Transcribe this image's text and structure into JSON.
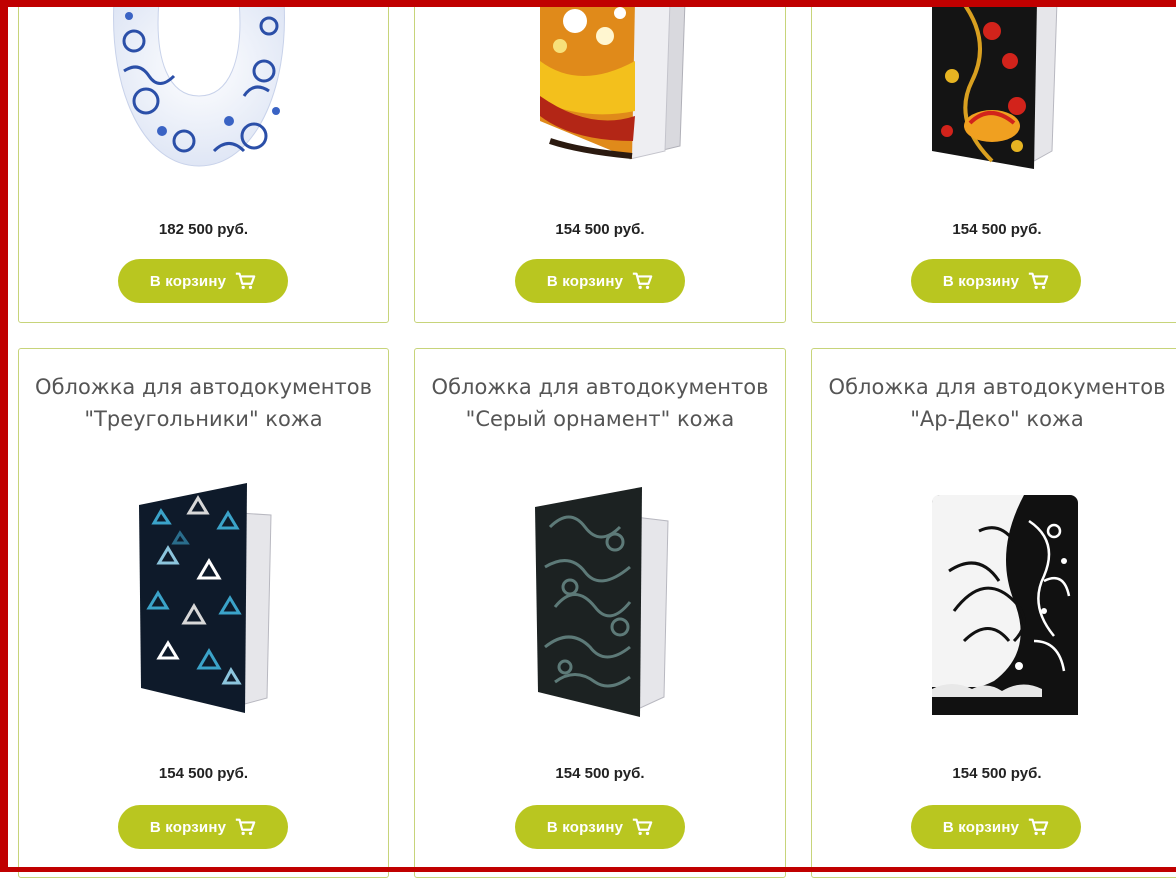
{
  "products": [
    {
      "title": "",
      "price": "182 500 руб.",
      "button": "В корзину"
    },
    {
      "title": "",
      "price": "154 500 руб.",
      "button": "В корзину"
    },
    {
      "title": "",
      "price": "154 500 руб.",
      "button": "В корзину"
    },
    {
      "title": "Обложка для автодокументов \"Треугольники\" кожа",
      "price": "154 500 руб.",
      "button": "В корзину"
    },
    {
      "title": "Обложка для автодокументов \"Серый орнамент\" кожа",
      "price": "154 500 руб.",
      "button": "В корзину"
    },
    {
      "title": "Обложка для автодокументов \"Ар-Деко\" кожа",
      "price": "154 500 руб.",
      "button": "В корзину"
    }
  ],
  "icons": {
    "cart": "cart-icon"
  },
  "colors": {
    "accent": "#b9c620",
    "card_border": "#c7d47a",
    "frame": "#c00000"
  }
}
